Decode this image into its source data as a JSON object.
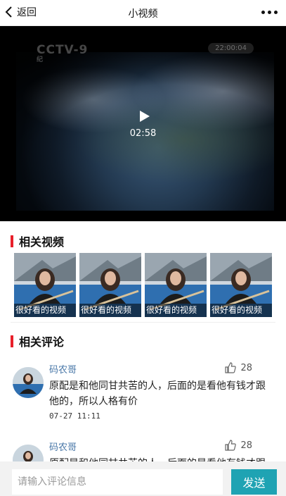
{
  "header": {
    "back_label": "返回",
    "title": "小视频",
    "more_icon": "more-dots-icon"
  },
  "player": {
    "channel_logo": "CCTV-9",
    "channel_sub": "纪",
    "duration": "02:58",
    "play_icon": "play-icon"
  },
  "related_videos": {
    "title": "相关视频",
    "items": [
      {
        "caption": "很好看的视频"
      },
      {
        "caption": "很好看的视频"
      },
      {
        "caption": "很好看的视频"
      },
      {
        "caption": "很好看的视频"
      }
    ]
  },
  "related_comments": {
    "title": "相关评论",
    "items": [
      {
        "user": "码农哥",
        "likes": "28",
        "text": "原配是和他同甘共苦的人，后面的是看他有钱才跟他的，所以人格有价",
        "time": "07-27 11:11"
      },
      {
        "user": "码农哥",
        "likes": "28",
        "text": "原配是和他同甘共苦的人，后面的是看他有钱才跟他的，所以人格有价",
        "time": ""
      }
    ]
  },
  "comment_input": {
    "placeholder": "请输入评论信息",
    "send_label": "发送"
  },
  "colors": {
    "accent_red": "#e8202a",
    "send_button": "#1fa3b3",
    "username": "#4a78a8"
  }
}
